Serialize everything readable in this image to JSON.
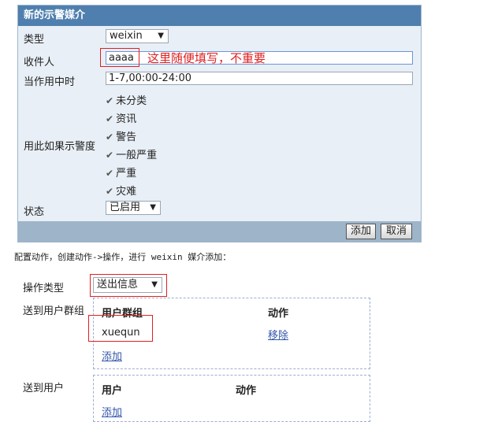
{
  "dialog": {
    "title": "新的示警媒介",
    "type_label": "类型",
    "type_value": "weixin",
    "recipient_label": "收件人",
    "recipient_value": "aaaa",
    "recipient_note": "这里随便填写，不重要",
    "period_label": "当作用中时",
    "period_value": "1-7,00:00-24:00",
    "severity_label": "用此如果示警度",
    "severities": [
      "未分类",
      "资讯",
      "警告",
      "一般严重",
      "严重",
      "灾难"
    ],
    "status_label": "状态",
    "status_value": "已启用",
    "add_label": "添加",
    "cancel_label": "取消"
  },
  "instruction": "配置动作，创建动作->操作，进行 weixin 媒介添加：",
  "action_form": {
    "op_type_label": "操作类型",
    "op_type_value": "送出信息",
    "group_label": "送到用户群组",
    "group_col_header": "用户群组",
    "action_col_header": "动作",
    "group_value": "xuequn",
    "remove_label": "移除",
    "group_add_label": "添加",
    "user_label": "送到用户",
    "user_col_header": "用户",
    "user_action_col_header": "动作",
    "user_add_label": "添加"
  },
  "colors": {
    "header_bg": "#4f7fae",
    "panel_bg": "#e8eff6",
    "footer_bg": "#9eb4c9",
    "annotation_red": "#e02020",
    "link_blue": "#3355aa"
  }
}
